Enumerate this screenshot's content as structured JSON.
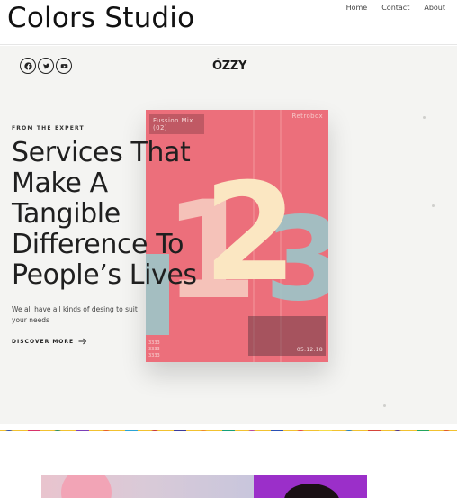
{
  "site": {
    "title": "Colors Studio"
  },
  "nav": {
    "items": [
      "Home",
      "Contact",
      "About"
    ]
  },
  "social": [
    {
      "icon": "facebook-icon"
    },
    {
      "icon": "twitter-icon"
    },
    {
      "icon": "youtube-icon"
    }
  ],
  "brand": {
    "logo": "ÓZZY"
  },
  "hero": {
    "eyebrow": "FROM THE EXPERT",
    "headline_lines": [
      "Services That",
      "Make A",
      "Tangible",
      "Difference To",
      "People’s Lives"
    ],
    "subtext": "We all have all kinds of desing to suit your needs",
    "cta": "DISCOVER MORE"
  },
  "artwork": {
    "tag_line1": "Fussion Mix",
    "tag_line2": "(02)",
    "brand": "Retrobox",
    "date": "05.12.18",
    "numerals": [
      "1",
      "2",
      "3"
    ],
    "colors": {
      "background": "#ec6f7b",
      "one": "#f6c7bd",
      "two": "#fbe7c2",
      "three": "#9cc6c9"
    }
  },
  "colors": {
    "accent": "#ec6f7b",
    "text": "#1f1f1f",
    "hero_bg": "#f4f4f2"
  }
}
